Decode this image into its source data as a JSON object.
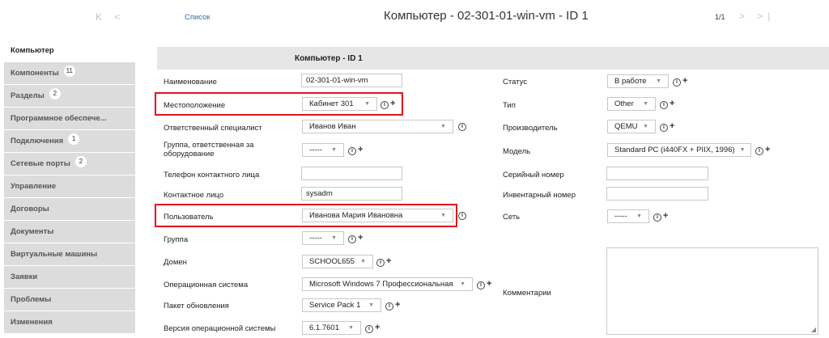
{
  "header": {
    "nav_left": "K <",
    "list_link": "Список",
    "title": "Компьютер - 02-301-01-win-vm - ID 1",
    "pager": "1/1",
    "nav_right": "> >|"
  },
  "sidebar": {
    "items": [
      {
        "label": "Компьютер",
        "badge": ""
      },
      {
        "label": "Компоненты",
        "badge": "11"
      },
      {
        "label": "Разделы",
        "badge": "2"
      },
      {
        "label": "Программное обеспече...",
        "badge": ""
      },
      {
        "label": "Подключения",
        "badge": "1"
      },
      {
        "label": "Сетевые порты",
        "badge": "2"
      },
      {
        "label": "Управление",
        "badge": ""
      },
      {
        "label": "Договоры",
        "badge": ""
      },
      {
        "label": "Документы",
        "badge": ""
      },
      {
        "label": "Виртуальные машины",
        "badge": ""
      },
      {
        "label": "Заявки",
        "badge": ""
      },
      {
        "label": "Проблемы",
        "badge": ""
      },
      {
        "label": "Изменения",
        "badge": ""
      }
    ]
  },
  "form": {
    "section_title": "Компьютер - ID 1",
    "name": {
      "label": "Наименование",
      "value": "02-301-01-win-vm"
    },
    "location": {
      "label": "Местоположение",
      "value": "Кабинет 301"
    },
    "tech": {
      "label": "Ответственный специалист",
      "value": "Иванов Иван"
    },
    "group_tech": {
      "label": "Группа, ответственная за оборудование",
      "value": "-----"
    },
    "contact_phone": {
      "label": "Телефон контактного лица",
      "value": ""
    },
    "contact": {
      "label": "Контактное лицо",
      "value": "sysadm"
    },
    "user": {
      "label": "Пользователь",
      "value": "Иванова Мария Ивановна"
    },
    "group": {
      "label": "Группа",
      "value": "-----"
    },
    "domain": {
      "label": "Домен",
      "value": "SCHOOL655"
    },
    "os": {
      "label": "Операционная система",
      "value": "Microsoft Windows 7 Профессиональная"
    },
    "sp": {
      "label": "Пакет обновления",
      "value": "Service Pack 1"
    },
    "os_version": {
      "label": "Версия операционной системы",
      "value": "6.1.7601"
    },
    "status": {
      "label": "Статус",
      "value": "В работе"
    },
    "type": {
      "label": "Тип",
      "value": "Other"
    },
    "manufacturer": {
      "label": "Производитель",
      "value": "QEMU"
    },
    "model": {
      "label": "Модель",
      "value": "Standard PC (i440FX + PIIX, 1996)"
    },
    "serial": {
      "label": "Серийный номер",
      "value": ""
    },
    "inventory": {
      "label": "Инвентарный номер",
      "value": ""
    },
    "network": {
      "label": "Сеть",
      "value": "-----"
    },
    "comments": {
      "label": "Комментарии",
      "value": ""
    }
  },
  "icons": {
    "info": "i",
    "plus": "+",
    "caret": "▼",
    "resize": "◢"
  },
  "colors": {
    "highlight": "#e0131e",
    "link": "#2a6fb0",
    "sidebar_bg": "#dcdcdc",
    "header_bg": "#e6e6e6"
  }
}
